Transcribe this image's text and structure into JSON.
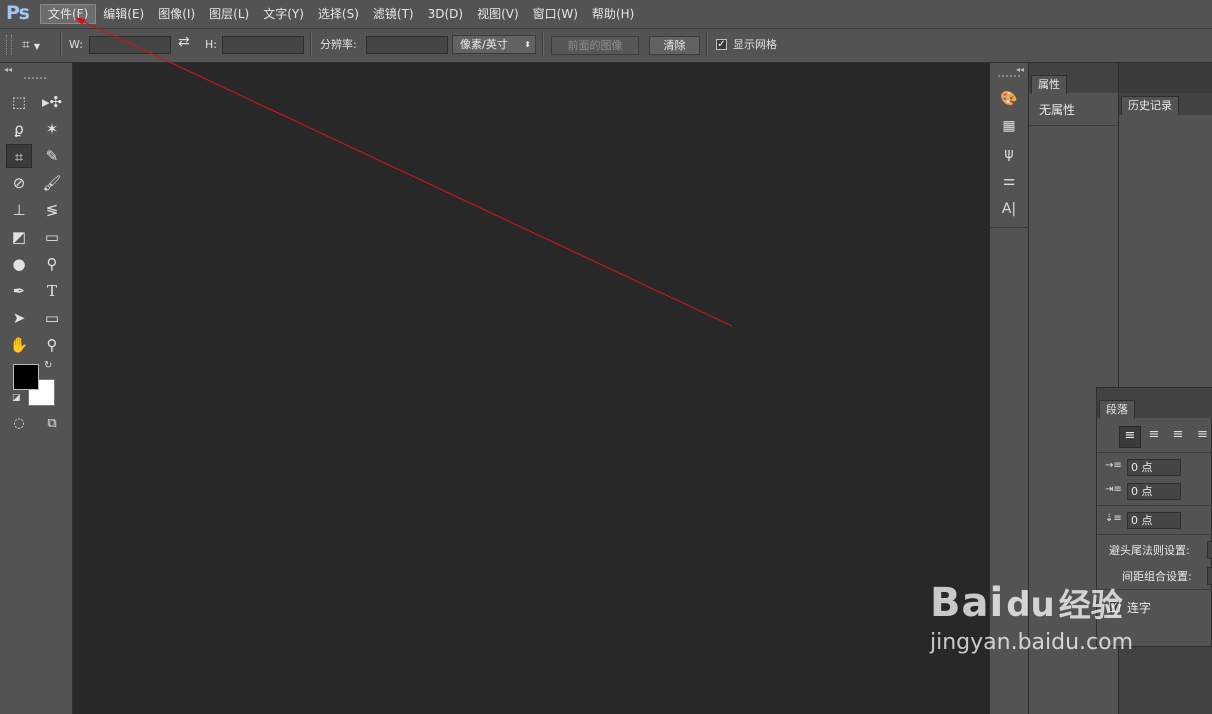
{
  "app": {
    "logo": "Ps"
  },
  "menu": {
    "items": [
      "文件(F)",
      "编辑(E)",
      "图像(I)",
      "图层(L)",
      "文字(Y)",
      "选择(S)",
      "滤镜(T)",
      "3D(D)",
      "视图(V)",
      "窗口(W)",
      "帮助(H)"
    ],
    "active_index": 0
  },
  "options_bar": {
    "w_label": "W:",
    "w_value": "",
    "swap_icon": "swap-arrows-icon",
    "h_label": "H:",
    "h_value": "",
    "resolution_label": "分辨率:",
    "resolution_value": "",
    "unit_select": "像素/英寸",
    "front_image_button": "前面的图像",
    "clear_button": "清除",
    "show_grid_label": "显示网格",
    "show_grid_checked": true
  },
  "toolbox": {
    "tools": [
      "rectangular-marquee-icon",
      "move-icon",
      "lasso-icon",
      "magic-wand-icon",
      "crop-icon",
      "eyedropper-icon",
      "healing-brush-icon",
      "brush-icon",
      "clone-stamp-icon",
      "history-brush-icon",
      "eraser-icon",
      "gradient-icon",
      "blur-icon",
      "dodge-icon",
      "pen-icon",
      "type-icon",
      "path-selection-icon",
      "rectangle-shape-icon",
      "hand-icon",
      "zoom-icon"
    ],
    "selected_tool": "crop-icon",
    "foreground_color": "#000000",
    "background_color": "#ffffff"
  },
  "right_dock": {
    "icons": [
      "color-palette-icon",
      "swatches-grid-icon",
      "brushes-icon",
      "adjustments-icon",
      "character-icon"
    ]
  },
  "properties_panel": {
    "tab": "属性",
    "content": "无属性"
  },
  "history_panel": {
    "tab": "历史记录"
  },
  "paragraph_panel": {
    "tab": "段落",
    "indent_left": "0 点",
    "indent_first": "0 点",
    "space_after": "0 点",
    "kinsoku_label": "避头尾法则设置:",
    "mojikumi_label": "间距组合设置:",
    "hyphenate_label": "连字",
    "hyphenate_checked": true
  },
  "watermark": {
    "brand": "Bai",
    "brand_cn": "经验",
    "url": "jingyan.baidu.com"
  },
  "annotation": {
    "color": "#c8161d"
  }
}
